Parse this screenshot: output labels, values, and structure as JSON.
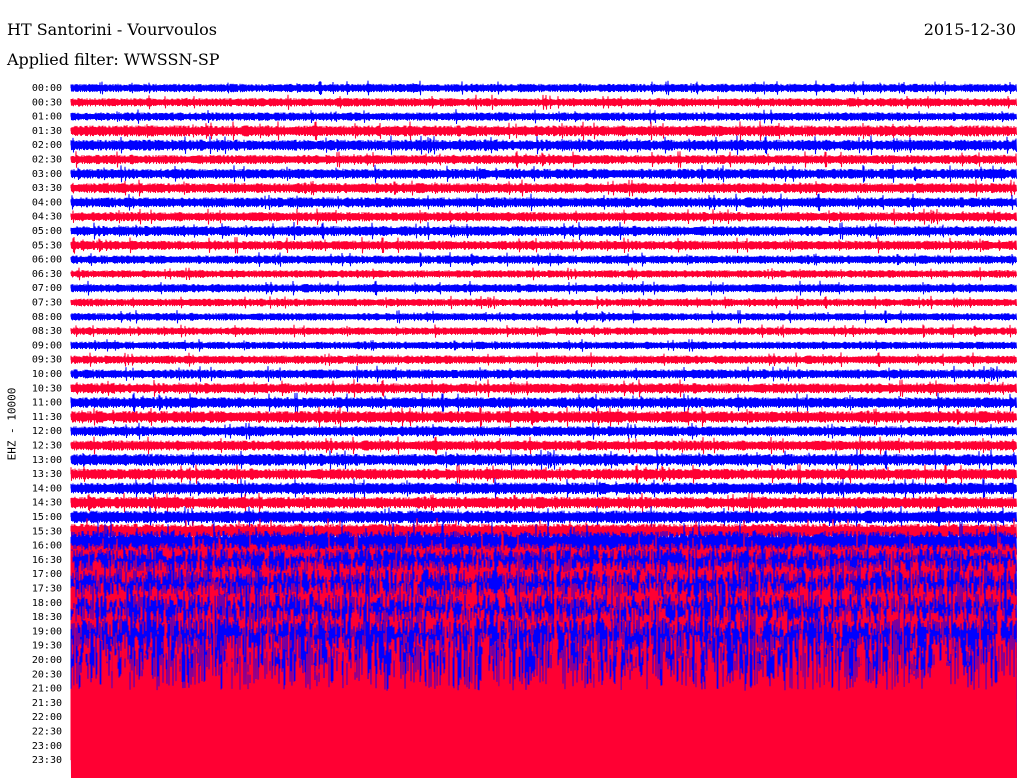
{
  "header": {
    "title": "HT Santorini - Vourvoulos",
    "date": "2015-12-30",
    "filter": "Applied filter: WWSSN-SP"
  },
  "channel_label": "EHZ - 10000",
  "colors": {
    "trace_a": "#0000ff",
    "trace_b": "#ff0033",
    "background": "#ffffff"
  },
  "chart_data": {
    "type": "line",
    "title": "HT Santorini - Vourvoulos",
    "ylabel": "EHZ - 10000",
    "row_labels": [
      "00:00",
      "00:30",
      "01:00",
      "01:30",
      "02:00",
      "02:30",
      "03:00",
      "03:30",
      "04:00",
      "04:30",
      "05:00",
      "05:30",
      "06:00",
      "06:30",
      "07:00",
      "07:30",
      "08:00",
      "08:30",
      "09:00",
      "09:30",
      "10:00",
      "10:30",
      "11:00",
      "11:30",
      "12:00",
      "12:30",
      "13:00",
      "13:30",
      "14:00",
      "14:30",
      "15:00",
      "15:30",
      "16:00",
      "16:30",
      "17:00",
      "17:30",
      "18:00",
      "18:30",
      "19:00",
      "19:30",
      "20:00",
      "20:30",
      "21:00",
      "21:30",
      "22:00",
      "22:30",
      "23:00",
      "23:30"
    ],
    "trace_colors": [
      "#0000ff",
      "#ff0033"
    ],
    "relative_amplitude": [
      1.0,
      1.0,
      1.0,
      1.3,
      1.3,
      1.1,
      1.2,
      1.2,
      1.2,
      1.1,
      1.2,
      1.1,
      1.0,
      0.9,
      1.0,
      0.9,
      0.9,
      0.9,
      0.9,
      1.0,
      1.1,
      1.2,
      1.3,
      1.4,
      1.2,
      1.2,
      1.4,
      1.3,
      1.4,
      1.4,
      1.5,
      1.8,
      3.5,
      4.0,
      6.0,
      7.0,
      8.0,
      8.5,
      9.0,
      9.5,
      10.0,
      10.0,
      10.0,
      10.0,
      9.5,
      9.0,
      30.0,
      30.0
    ]
  }
}
